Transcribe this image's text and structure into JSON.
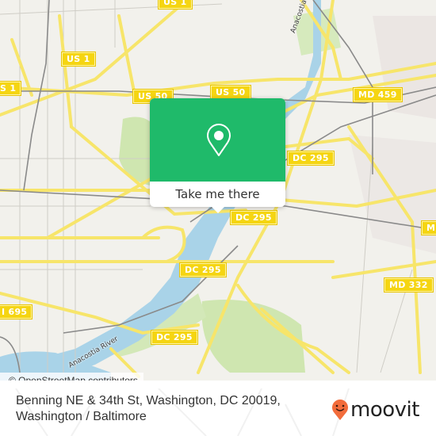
{
  "map": {
    "shields": [
      {
        "id": "us1-top",
        "label": "US 1"
      },
      {
        "id": "us1-left",
        "label": "US 1"
      },
      {
        "id": "us1-west",
        "label": "S 1"
      },
      {
        "id": "us50-a",
        "label": "US 50"
      },
      {
        "id": "us50-b",
        "label": "US 50"
      },
      {
        "id": "md459",
        "label": "MD 459"
      },
      {
        "id": "dc295-a",
        "label": "DC 295"
      },
      {
        "id": "dc295-b",
        "label": "DC 295"
      },
      {
        "id": "dc295-c",
        "label": "DC 295"
      },
      {
        "id": "dc295-d",
        "label": "DC 295"
      },
      {
        "id": "md-partial",
        "label": "MD"
      },
      {
        "id": "md332",
        "label": "MD 332"
      },
      {
        "id": "i695",
        "label": "I 695"
      }
    ],
    "river_labels": [
      "Anacostia River",
      "Anacostia River"
    ],
    "colors": {
      "land": "#f2f1ec",
      "water": "#a9d3e8",
      "park": "#cfe6b0",
      "road": "#f7e56a",
      "rail": "#8a8a8a",
      "shield": "#f5d512"
    }
  },
  "popup": {
    "pin_icon": "location-pin-icon",
    "button_label": "Take me there",
    "accent_color": "#1fba6a"
  },
  "attribution": "© OpenStreetMap contributors",
  "footer": {
    "address_line1": "Benning NE & 34th St, Washington, DC 20019,",
    "address_line2": "Washington / Baltimore",
    "brand": "moovit",
    "brand_color": "#f26c3b"
  }
}
